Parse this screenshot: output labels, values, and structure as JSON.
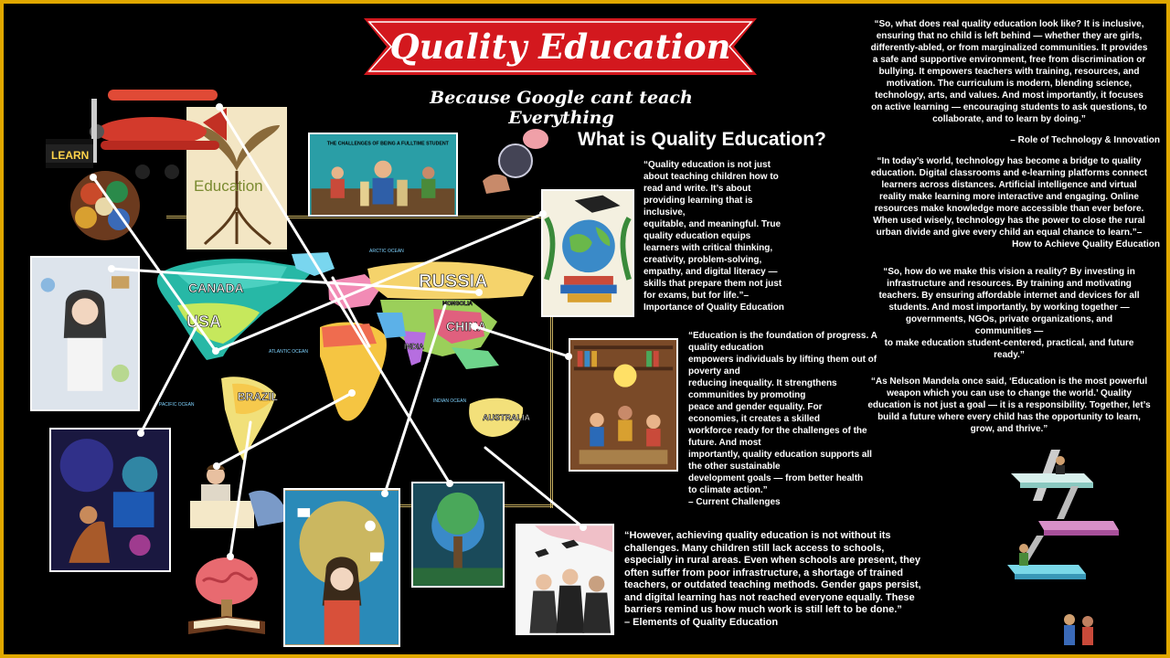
{
  "banner": {
    "title": "Quality Education",
    "subtitle": "Because Google cant teach Everything"
  },
  "heading": "What is Quality Education?",
  "map_labels": {
    "canada": "CANADA",
    "usa": "USA",
    "brazil": "BRAZIL",
    "russia": "RUSSIA",
    "china": "CHINA",
    "australia": "AUSTRALIA",
    "india": "INDIA",
    "mongolia": "MONGOLIA",
    "arctic": "ARCTIC OCEAN",
    "atlantic": "ATLANTIC OCEAN",
    "pacific": "PACIFIC OCEAN",
    "indian": "INDIAN OCEAN"
  },
  "posters": {
    "education_book_text": "Education",
    "challenges_title": "THE CHALLENGES OF BEING A FULLTIME STUDENT",
    "learn_text": "LEARN"
  },
  "paragraphs": {
    "what_is": {
      "text": "“Quality education is not just\nabout teaching children how to\nread and write. It’s about\nproviding learning that is\ninclusive,\nequitable, and meaningful. True\nquality education equips\nlearners with critical thinking,\ncreativity, problem-solving,\nempathy, and digital literacy —\nskills that prepare them not just\nfor exams, but for life.”–",
      "cite": "Importance of Quality Education"
    },
    "foundation": {
      "text": "“Education is the foundation of progress. A\nquality education\nempowers individuals by lifting them out of\npoverty and\nreducing inequality. It strengthens\ncommunities by promoting\npeace and gender equality. For\neconomies, it creates a skilled\nworkforce ready for the challenges of the\nfuture. And most\nimportantly, quality education supports all\nthe other sustainable\ndevelopment goals — from better health\nto climate action.”",
      "cite": "– Current Challenges"
    },
    "challenges": {
      "text": "“However, achieving quality education is not without its\nchallenges. Many children still lack access to schools,\nespecially in rural areas. Even when schools are present, they\noften suffer from poor infrastructure, a shortage of trained\nteachers, or outdated teaching methods. Gender gaps persist,\nand digital learning has not reached everyone equally. These\nbarriers remind us how much work is still left to be done.”",
      "cite": "– Elements of Quality Education"
    },
    "real_quality": {
      "text": "“So, what does real quality education look like? It is inclusive,\nensuring that no child is left behind — whether they are girls,\ndifferently-abled, or from marginalized communities. It provides\na safe and supportive environment, free from discrimination or\nbullying. It empowers teachers with training, resources, and\nmotivation. The curriculum is modern, blending science,\ntechnology, arts, and values. And most importantly, it focuses\non active learning — encouraging students to ask questions, to\ncollaborate, and to learn by doing.”",
      "cite": "– Role of Technology & Innovation"
    },
    "technology": {
      "text": "“In today’s world, technology has become a bridge to quality\neducation. Digital classrooms and e-learning platforms connect\nlearners across distances. Artificial intelligence and virtual\nreality make learning more interactive and engaging. Online\nresources make knowledge more accessible than ever before.\nWhen used wisely, technology has the power to close the rural\nurban divide and give every child an equal chance to learn.”–",
      "cite": "How to Achieve Quality Education"
    },
    "vision": {
      "text": "“So, how do we make this vision a reality? By investing in\ninfrastructure and resources. By training and motivating\nteachers. By ensuring affordable internet and devices for all\nstudents. And most importantly, by working together —\ngovernments, NGOs, private organizations, and\ncommunities —\nto make education student-centered, practical, and future\nready.”",
      "cite": ""
    },
    "mandela": {
      "text": "“As Nelson Mandela once said, ‘Education is the most powerful\nweapon which you can use to change the world.’ Quality\neducation is not just a goal — it is a responsibility. Together, let’s\nbuild a future where every child has the opportunity to learn,\ngrow, and thrive.”",
      "cite": ""
    }
  },
  "colors": {
    "background": "#000000",
    "border": "#e0a800",
    "banner_red": "#d3181e",
    "text": "#ffffff"
  }
}
